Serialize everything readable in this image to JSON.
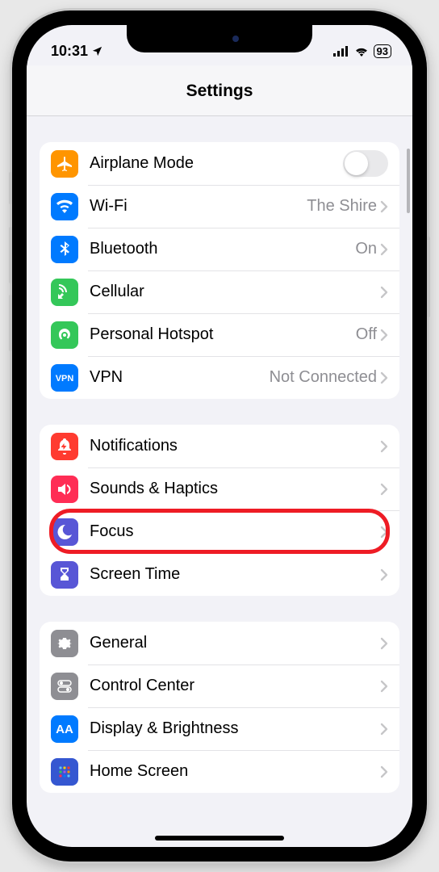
{
  "status": {
    "time": "10:31",
    "battery": "93"
  },
  "header": {
    "title": "Settings"
  },
  "groups": [
    {
      "rows": [
        {
          "id": "airplane-mode",
          "label": "Airplane Mode",
          "icon": "airplane",
          "color": "#ff9500",
          "toggle": false
        },
        {
          "id": "wifi",
          "label": "Wi-Fi",
          "value": "The Shire",
          "icon": "wifi",
          "color": "#007aff",
          "chevron": true
        },
        {
          "id": "bluetooth",
          "label": "Bluetooth",
          "value": "On",
          "icon": "bluetooth",
          "color": "#007aff",
          "chevron": true
        },
        {
          "id": "cellular",
          "label": "Cellular",
          "icon": "cellular",
          "color": "#34c759",
          "chevron": true
        },
        {
          "id": "personal-hotspot",
          "label": "Personal Hotspot",
          "value": "Off",
          "icon": "hotspot",
          "color": "#34c759",
          "chevron": true
        },
        {
          "id": "vpn",
          "label": "VPN",
          "value": "Not Connected",
          "icon": "vpn-text",
          "color": "#007aff",
          "chevron": true
        }
      ]
    },
    {
      "rows": [
        {
          "id": "notifications",
          "label": "Notifications",
          "icon": "bell",
          "color": "#ff3b30",
          "chevron": true
        },
        {
          "id": "sounds-haptics",
          "label": "Sounds & Haptics",
          "icon": "speaker",
          "color": "#ff2d55",
          "chevron": true
        },
        {
          "id": "focus",
          "label": "Focus",
          "icon": "moon",
          "color": "#5856d6",
          "chevron": true,
          "highlight": true
        },
        {
          "id": "screen-time",
          "label": "Screen Time",
          "icon": "hourglass",
          "color": "#5856d6",
          "chevron": true
        }
      ]
    },
    {
      "rows": [
        {
          "id": "general",
          "label": "General",
          "icon": "gear",
          "color": "#8e8e93",
          "chevron": true
        },
        {
          "id": "control-center",
          "label": "Control Center",
          "icon": "switches",
          "color": "#8e8e93",
          "chevron": true
        },
        {
          "id": "display",
          "label": "Display & Brightness",
          "icon": "aa",
          "color": "#007aff",
          "chevron": true
        },
        {
          "id": "home-screen",
          "label": "Home Screen",
          "icon": "grid",
          "color": "#3557d1",
          "chevron": true
        }
      ]
    }
  ]
}
